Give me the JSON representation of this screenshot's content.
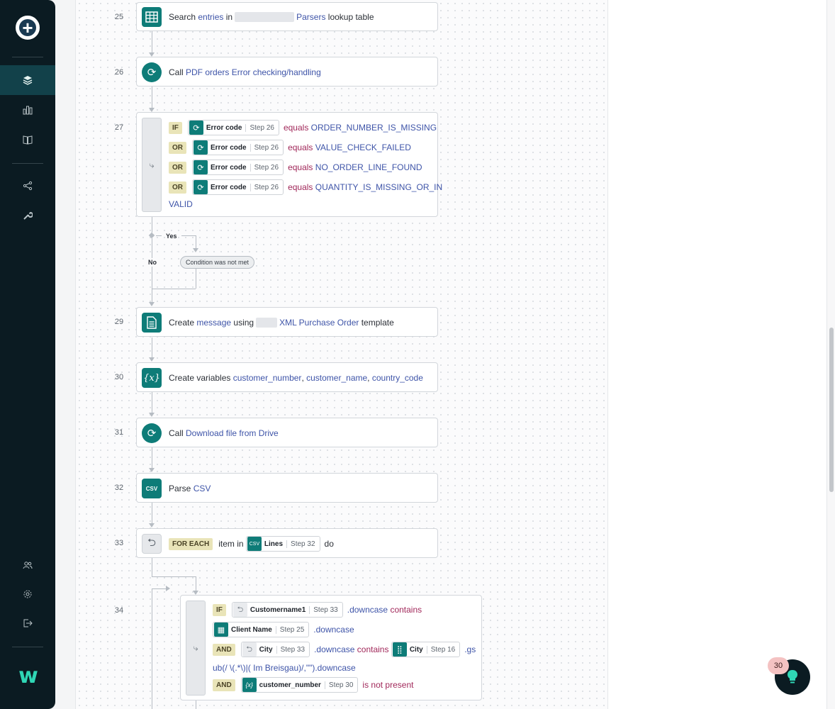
{
  "steps": {
    "s25": {
      "num": "25",
      "verb": "Search",
      "obj": "entries",
      "prep": "in",
      "name": "Parsers",
      "tail": "lookup table"
    },
    "s26": {
      "num": "26",
      "verb": "Call",
      "link": "PDF orders Error checking/handling"
    },
    "s27": {
      "num": "27",
      "rows": [
        {
          "kw": "IF",
          "pill": "Error code",
          "step": "Step 26",
          "op": "equals",
          "val": "ORDER_NUMBER_IS_MISSING"
        },
        {
          "kw": "OR",
          "pill": "Error code",
          "step": "Step 26",
          "op": "equals",
          "val": "VALUE_CHECK_FAILED"
        },
        {
          "kw": "OR",
          "pill": "Error code",
          "step": "Step 26",
          "op": "equals",
          "val": "NO_ORDER_LINE_FOUND"
        },
        {
          "kw": "OR",
          "pill": "Error code",
          "step": "Step 26",
          "op": "equals",
          "val": "QUANTITY_IS_MISSING_OR_IN",
          "cont": "VALID"
        }
      ],
      "yes": "Yes",
      "no": "No",
      "not_met": "Condition was not met"
    },
    "s29": {
      "num": "29",
      "verb": "Create",
      "obj": "message",
      "prep": "using",
      "name": "XML Purchase Order",
      "tail": "template"
    },
    "s30": {
      "num": "30",
      "verb": "Create variables",
      "v1": "customer_number",
      "sep1": ",",
      "v2": "customer_name",
      "sep2": ",",
      "v3": "country_code"
    },
    "s31": {
      "num": "31",
      "verb": "Call",
      "link": "Download file from Drive"
    },
    "s32": {
      "num": "32",
      "verb": "Parse",
      "link": "CSV"
    },
    "s33": {
      "num": "33",
      "kw": "FOR EACH",
      "pre": "item in",
      "pill": "Lines",
      "step": "Step 32",
      "post": "do"
    },
    "s34": {
      "num": "34",
      "r1": {
        "kw": "IF",
        "pill": "Customername1",
        "step": "Step 33",
        "method": ".downcase",
        "op": "contains"
      },
      "r2": {
        "pill": "Client Name",
        "step": "Step 25",
        "method": ".downcase"
      },
      "r3": {
        "kw": "AND",
        "pill": "City",
        "step": "Step 33",
        "method": ".downcase",
        "op": "contains",
        "pill2": "City",
        "step2": "Step 16",
        "tail": ".gs"
      },
      "r3b": {
        "cont": "ub(/ \\(.*\\)|( Im Breisgau)/,\"\").downcase"
      },
      "r4": {
        "kw": "AND",
        "pill": "customer_number",
        "step": "Step 30",
        "op": "is not present"
      }
    }
  },
  "notification_count": "30",
  "colors": {
    "accent": "#0e7c78",
    "link": "#3e54a8",
    "operator": "#a1285a",
    "sidebar": "#0b1b22"
  }
}
